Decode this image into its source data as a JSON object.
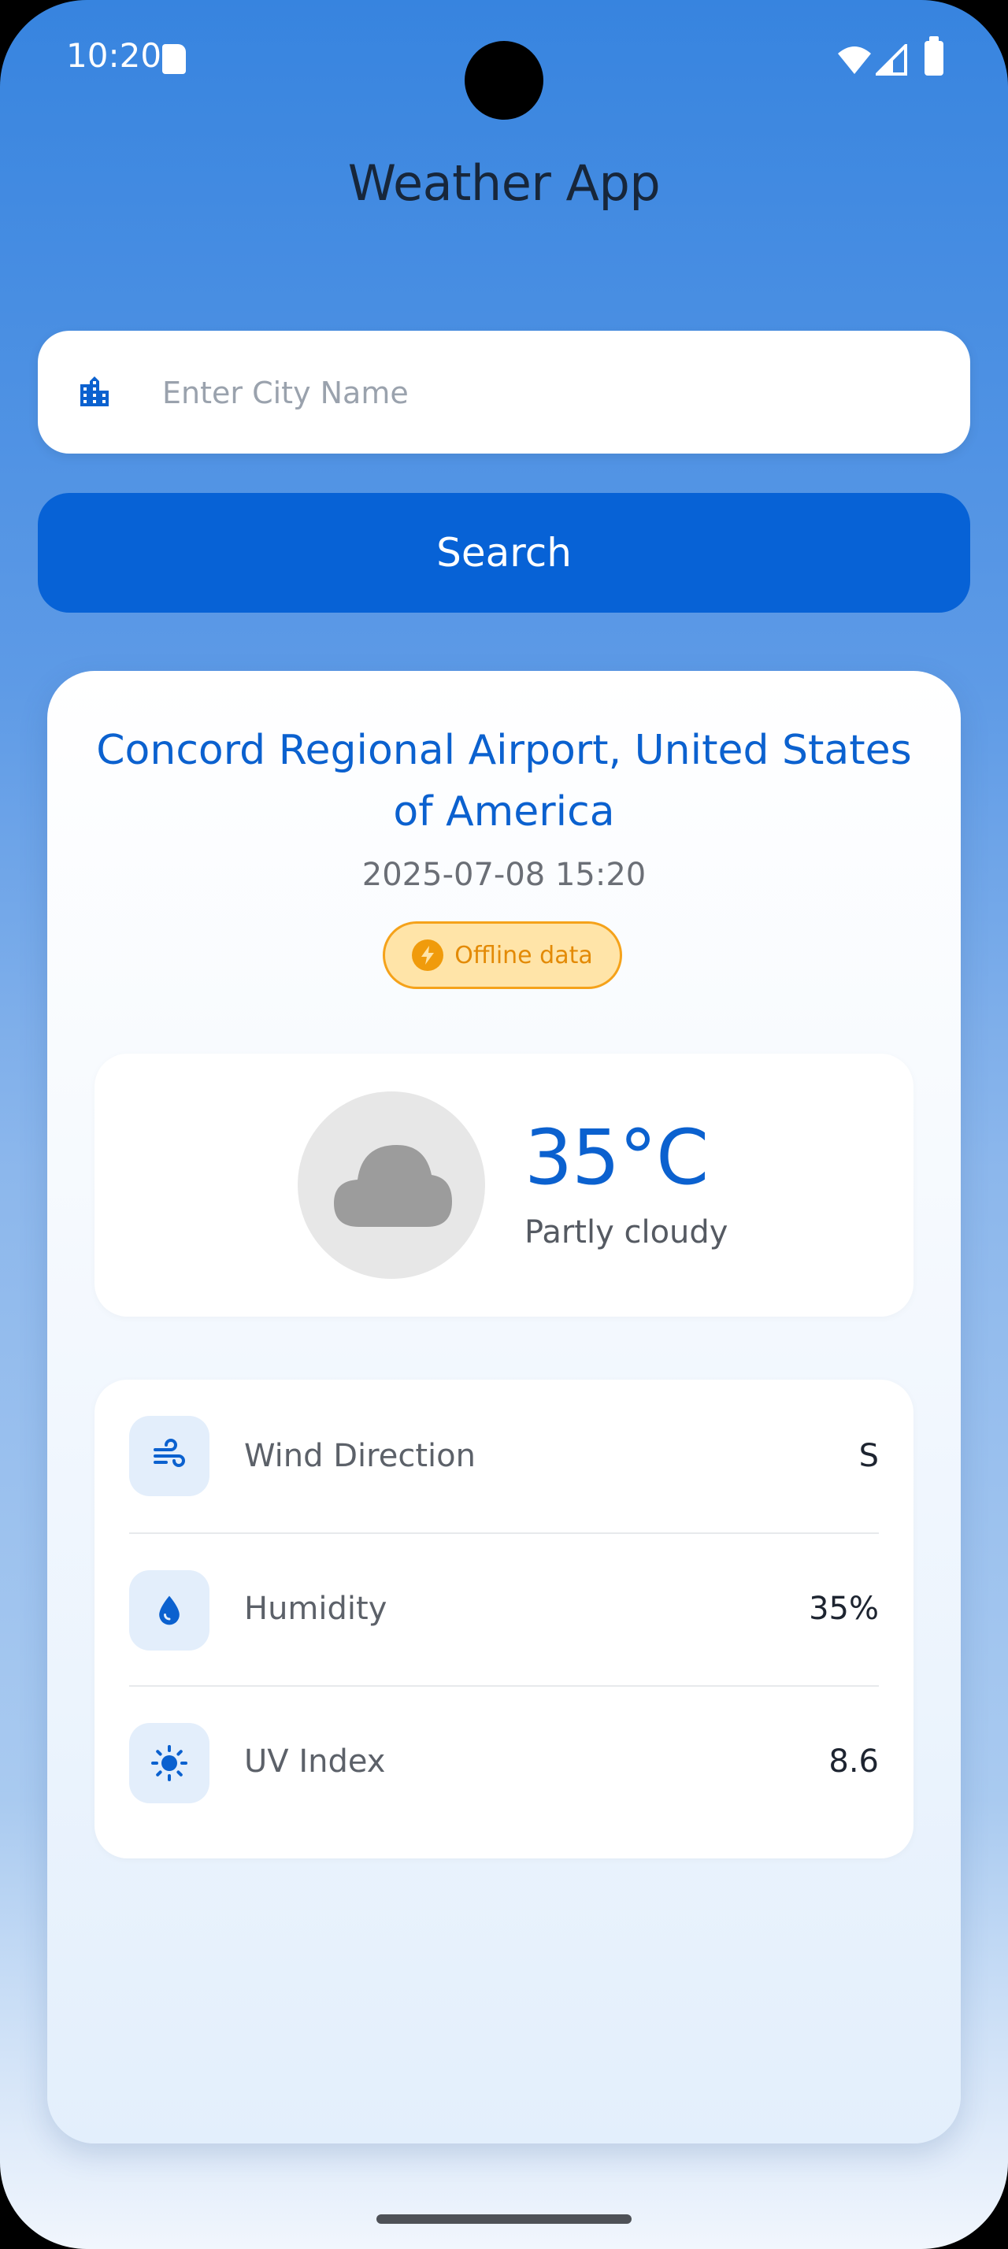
{
  "status_bar": {
    "time": "10:20"
  },
  "app": {
    "title": "Weather App"
  },
  "search": {
    "placeholder": "Enter City Name",
    "value": "",
    "button_label": "Search",
    "icon": "city-icon"
  },
  "weather": {
    "location": "Concord Regional Airport, United States of America",
    "datetime": "2025-07-08 15:20",
    "badge": "Offline data",
    "temperature": "35°C",
    "condition": "Partly cloudy",
    "condition_icon": "cloud-icon"
  },
  "details": [
    {
      "label": "Wind Direction",
      "value": "S",
      "icon": "wind-icon"
    },
    {
      "label": "Humidity",
      "value": "35%",
      "icon": "water-drop-icon"
    },
    {
      "label": "UV Index",
      "value": "8.6",
      "icon": "sun-icon"
    }
  ],
  "colors": {
    "primary": "#0762D6",
    "accent_text": "#0B61CF",
    "badge_background": "#FFE4A8",
    "badge_border": "#F5A21A",
    "badge_text": "#E38A06"
  }
}
